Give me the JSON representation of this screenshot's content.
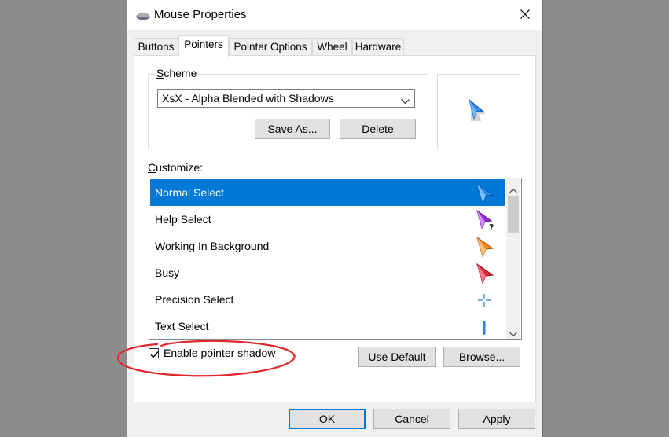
{
  "window": {
    "title": "Mouse Properties",
    "close_symbol": "✕"
  },
  "tabs": [
    {
      "label": "Buttons"
    },
    {
      "label": "Pointers"
    },
    {
      "label": "Pointer Options"
    },
    {
      "label": "Wheel"
    },
    {
      "label": "Hardware"
    }
  ],
  "active_tab": "Pointers",
  "scheme": {
    "group_label": "Scheme",
    "selected": "XsX - Alpha Blended with Shadows",
    "save_as_label": "Save As...",
    "delete_label": "Delete"
  },
  "customize": {
    "label": "Customize:",
    "items": [
      {
        "label": "Normal Select",
        "icon": "blue-arrow-cursor-icon",
        "color": "#1f7de0",
        "selected": true
      },
      {
        "label": "Help Select",
        "icon": "purple-help-cursor-icon",
        "color": "#9b2fd6"
      },
      {
        "label": "Working In Background",
        "icon": "orange-arrow-cursor-icon",
        "color": "#f08a24"
      },
      {
        "label": "Busy",
        "icon": "red-arrow-cursor-icon",
        "color": "#e02a3a"
      },
      {
        "label": "Precision Select",
        "icon": "crosshair-cursor-icon",
        "color": "#4a90e2"
      },
      {
        "label": "Text Select",
        "icon": "text-beam-cursor-icon",
        "color": "#2f7de0"
      }
    ]
  },
  "options": {
    "enable_shadow_label": "Enable pointer shadow",
    "enable_shadow_checked": true,
    "use_default_label": "Use Default",
    "browse_label": "Browse..."
  },
  "footer": {
    "ok_label": "OK",
    "cancel_label": "Cancel",
    "apply_label": "Apply"
  },
  "annotation_color": "#e3262b"
}
